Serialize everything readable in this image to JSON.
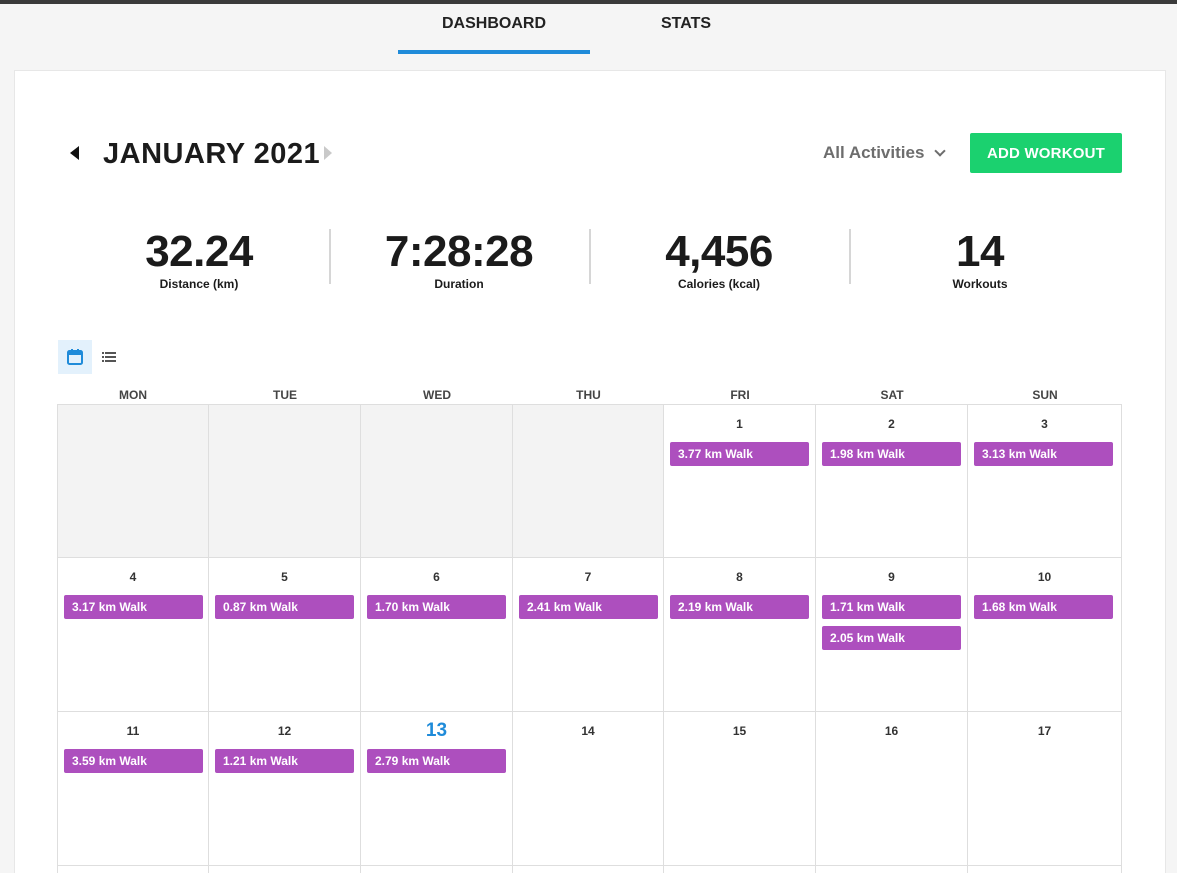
{
  "tabs": [
    {
      "label": "DASHBOARD",
      "active": true
    },
    {
      "label": "STATS",
      "active": false
    }
  ],
  "header": {
    "month_title": "JANUARY 2021",
    "filter_label": "All Activities",
    "add_button": "ADD WORKOUT"
  },
  "stats": [
    {
      "value": "32.24",
      "label": "Distance (km)"
    },
    {
      "value": "7:28:28",
      "label": "Duration"
    },
    {
      "value": "4,456",
      "label": "Calories (kcal)"
    },
    {
      "value": "14",
      "label": "Workouts"
    }
  ],
  "days_of_week": [
    "MON",
    "TUE",
    "WED",
    "THU",
    "FRI",
    "SAT",
    "SUN"
  ],
  "colors": {
    "accent": "#1f8bd9",
    "add_button": "#1bd16f",
    "workout": "#ad4fbe"
  },
  "calendar": {
    "weeks": [
      [
        {
          "day": "",
          "workouts": []
        },
        {
          "day": "",
          "workouts": []
        },
        {
          "day": "",
          "workouts": []
        },
        {
          "day": "",
          "workouts": []
        },
        {
          "day": "1",
          "workouts": [
            "3.77 km Walk"
          ]
        },
        {
          "day": "2",
          "workouts": [
            "1.98 km Walk"
          ]
        },
        {
          "day": "3",
          "workouts": [
            "3.13 km Walk"
          ]
        }
      ],
      [
        {
          "day": "4",
          "workouts": [
            "3.17 km Walk"
          ]
        },
        {
          "day": "5",
          "workouts": [
            "0.87 km Walk"
          ]
        },
        {
          "day": "6",
          "workouts": [
            "1.70 km Walk"
          ]
        },
        {
          "day": "7",
          "workouts": [
            "2.41 km Walk"
          ]
        },
        {
          "day": "8",
          "workouts": [
            "2.19 km Walk"
          ]
        },
        {
          "day": "9",
          "workouts": [
            "1.71 km Walk",
            "2.05 km Walk"
          ]
        },
        {
          "day": "10",
          "workouts": [
            "1.68 km Walk"
          ]
        }
      ],
      [
        {
          "day": "11",
          "workouts": [
            "3.59 km Walk"
          ]
        },
        {
          "day": "12",
          "workouts": [
            "1.21 km Walk"
          ]
        },
        {
          "day": "13",
          "workouts": [
            "2.79 km Walk"
          ],
          "today": true
        },
        {
          "day": "14",
          "workouts": []
        },
        {
          "day": "15",
          "workouts": []
        },
        {
          "day": "16",
          "workouts": []
        },
        {
          "day": "17",
          "workouts": []
        }
      ],
      [
        {
          "day": "",
          "workouts": []
        },
        {
          "day": "",
          "workouts": []
        },
        {
          "day": "",
          "workouts": []
        },
        {
          "day": "",
          "workouts": []
        },
        {
          "day": "",
          "workouts": []
        },
        {
          "day": "",
          "workouts": []
        },
        {
          "day": "",
          "workouts": []
        }
      ]
    ]
  }
}
